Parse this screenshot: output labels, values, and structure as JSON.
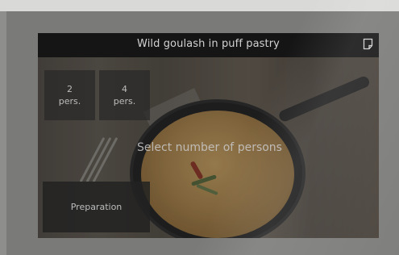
{
  "app": {
    "title": "Wild goulash in puff pastry"
  },
  "header": {
    "recipe_icon": "document-icon"
  },
  "persons": {
    "options": [
      {
        "number": "2",
        "unit": "pers."
      },
      {
        "number": "4",
        "unit": "pers."
      }
    ],
    "prompt": "Select number of persons"
  },
  "actions": {
    "preparation_label": "Preparation"
  },
  "colors": {
    "header_bg": "#151515",
    "button_bg": "#282828",
    "text": "#d2d2d2"
  }
}
